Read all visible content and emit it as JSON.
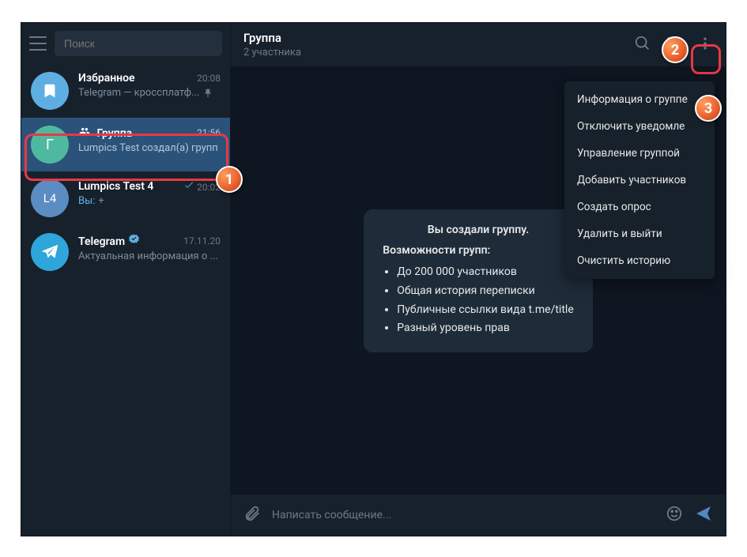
{
  "search": {
    "placeholder": "Поиск"
  },
  "chats": [
    {
      "name": "Избранное",
      "time": "20:08",
      "preview": "Telegram — кроссплатф...",
      "avatar_bg": "#5eaee4"
    },
    {
      "name": "Группа",
      "time": "21:56",
      "preview": "Lumpics Test создал(а) групп",
      "avatar_letter": "Г",
      "avatar_bg": "#4fb99f"
    },
    {
      "name": "Lumpics Test 4",
      "time": "20:02",
      "preview_prefix": "Вы:",
      "preview": " +",
      "avatar_letter": "L4",
      "avatar_bg": "#5b8cc2"
    },
    {
      "name": "Telegram",
      "time": "17.11.20",
      "preview": "Актуальная информация о ...",
      "avatar_bg": "#2ea6da"
    }
  ],
  "header": {
    "title": "Группа",
    "subtitle": "2 участника"
  },
  "service_msg": {
    "title": "Вы создали группу.",
    "subtitle": "Возможности групп:",
    "items": [
      "До 200 000 участников",
      "Общая история переписки",
      "Публичные ссылки вида t.me/title",
      "Разный уровень прав"
    ]
  },
  "composer": {
    "placeholder": "Написать сообщение..."
  },
  "menu": {
    "items": [
      "Информация о группе",
      "Отключить уведомле",
      "Управление группой",
      "Добавить участников",
      "Создать опрос",
      "Удалить и выйти",
      "Очистить историю"
    ]
  },
  "badges": {
    "b1": "1",
    "b2": "2",
    "b3": "3"
  },
  "titlebar": {
    "min": "—",
    "max": "☐",
    "close": "✕"
  }
}
